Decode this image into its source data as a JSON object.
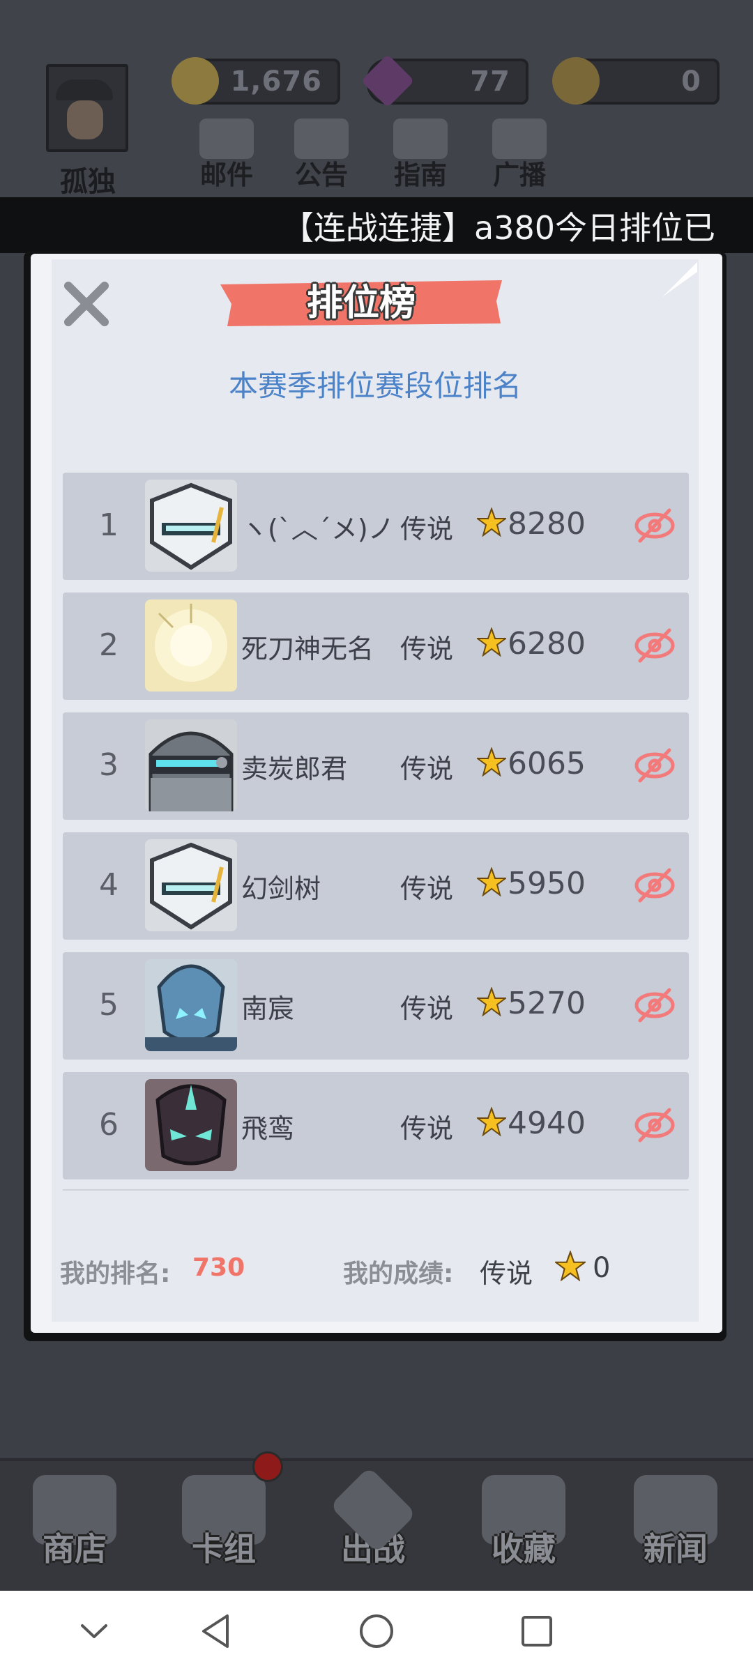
{
  "player": {
    "name": "孤独"
  },
  "currencies": [
    {
      "icon": "crown-coin-icon",
      "value": "1,676",
      "color": "#c9a23a"
    },
    {
      "icon": "purple-gem-icon",
      "value": "77",
      "color": "#7a3c8c"
    },
    {
      "icon": "star-medal-icon",
      "value": "0",
      "color": "#b0893a"
    }
  ],
  "top_menu": [
    {
      "label": "邮件",
      "icon": "mail-icon"
    },
    {
      "label": "公告",
      "icon": "scroll-icon"
    },
    {
      "label": "指南",
      "icon": "book-icon"
    },
    {
      "label": "广播",
      "icon": "megaphone-icon"
    }
  ],
  "ticker": {
    "text": "【连战连捷】a380今日排位已"
  },
  "modal": {
    "title": "排位榜",
    "subtitle": "本赛季排位赛段位排名",
    "rows": [
      {
        "rank": "1",
        "name": "ヽ(ˋ︿ˊメ)ノ",
        "tier": "传说",
        "score": "8280",
        "avatar": "white-knight-avatar"
      },
      {
        "rank": "2",
        "name": "死刀神无名",
        "tier": "传说",
        "score": "6280",
        "avatar": "light-burst-avatar"
      },
      {
        "rank": "3",
        "name": "卖炭郎君",
        "tier": "传说",
        "score": "6065",
        "avatar": "robot-helmet-avatar"
      },
      {
        "rank": "4",
        "name": "幻剑树",
        "tier": "传说",
        "score": "5950",
        "avatar": "white-knight-avatar"
      },
      {
        "rank": "5",
        "name": "南宸",
        "tier": "传说",
        "score": "5270",
        "avatar": "blue-alien-avatar"
      },
      {
        "rank": "6",
        "name": "飛鸾",
        "tier": "传说",
        "score": "4940",
        "avatar": "dark-mask-avatar"
      }
    ],
    "my_rank_label": "我的排名:",
    "my_rank_value": "730",
    "my_score_label": "我的成绩:",
    "my_tier": "传说",
    "my_score": "0"
  },
  "bottom_nav": [
    {
      "label": "商店",
      "icon": "shop-icon"
    },
    {
      "label": "卡组",
      "icon": "cards-icon"
    },
    {
      "label": "出战",
      "icon": "crossed-swords-icon"
    },
    {
      "label": "收藏",
      "icon": "chest-icon"
    },
    {
      "label": "新闻",
      "icon": "news-tv-icon"
    }
  ],
  "colors": {
    "accent_red": "#f07468",
    "subtitle_blue": "#4c82c8",
    "star_gold": "#f6c020"
  }
}
